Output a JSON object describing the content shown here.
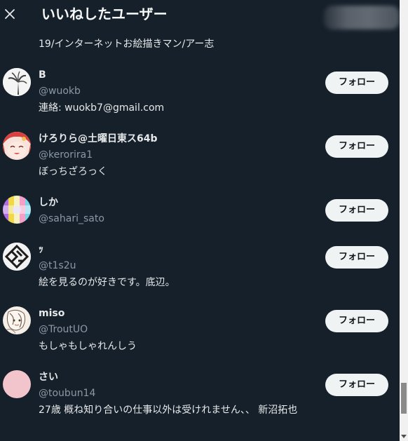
{
  "header": {
    "title": "いいねしたユーザー",
    "close_icon": "close-icon"
  },
  "partial_bio": "19/インターネットお絵描きマン/アー志",
  "users": [
    {
      "display_name": "B",
      "handle": "@wuokb",
      "bio": "連絡: wuokb7@gmail.com",
      "follow_label": "フォロー",
      "avatar": "palm-tree-avatar"
    },
    {
      "display_name": "けろりら@土曜日東ス64b",
      "handle": "@kerorira1",
      "bio": "ぼっちざろっく",
      "follow_label": "フォロー",
      "avatar": "red-hair-girl-avatar"
    },
    {
      "display_name": "しか",
      "handle": "@sahari_sato",
      "bio": "",
      "follow_label": "フォロー",
      "avatar": "colorful-avatar"
    },
    {
      "display_name": "ｯ",
      "handle": "@t1s2u",
      "bio": "絵を見るのが好きです。底辺。",
      "follow_label": "フォロー",
      "avatar": "geometric-logo-avatar"
    },
    {
      "display_name": "miso",
      "handle": "@TroutUO",
      "bio": "もしゃもしゃれんしう",
      "follow_label": "フォロー",
      "avatar": "sketch-character-avatar"
    },
    {
      "display_name": "さい",
      "handle": "@toubun14",
      "bio": "27歳 概ね知り合いの仕事以外は受けれません、、 新沼拓也",
      "follow_label": "フォロー",
      "avatar": "pink-circle-avatar"
    }
  ],
  "colors": {
    "background": "#15202b",
    "primary_text": "#e7e9ea",
    "secondary_text": "#8b98a5",
    "button_bg": "#eff3f4",
    "button_text": "#0f1419"
  }
}
